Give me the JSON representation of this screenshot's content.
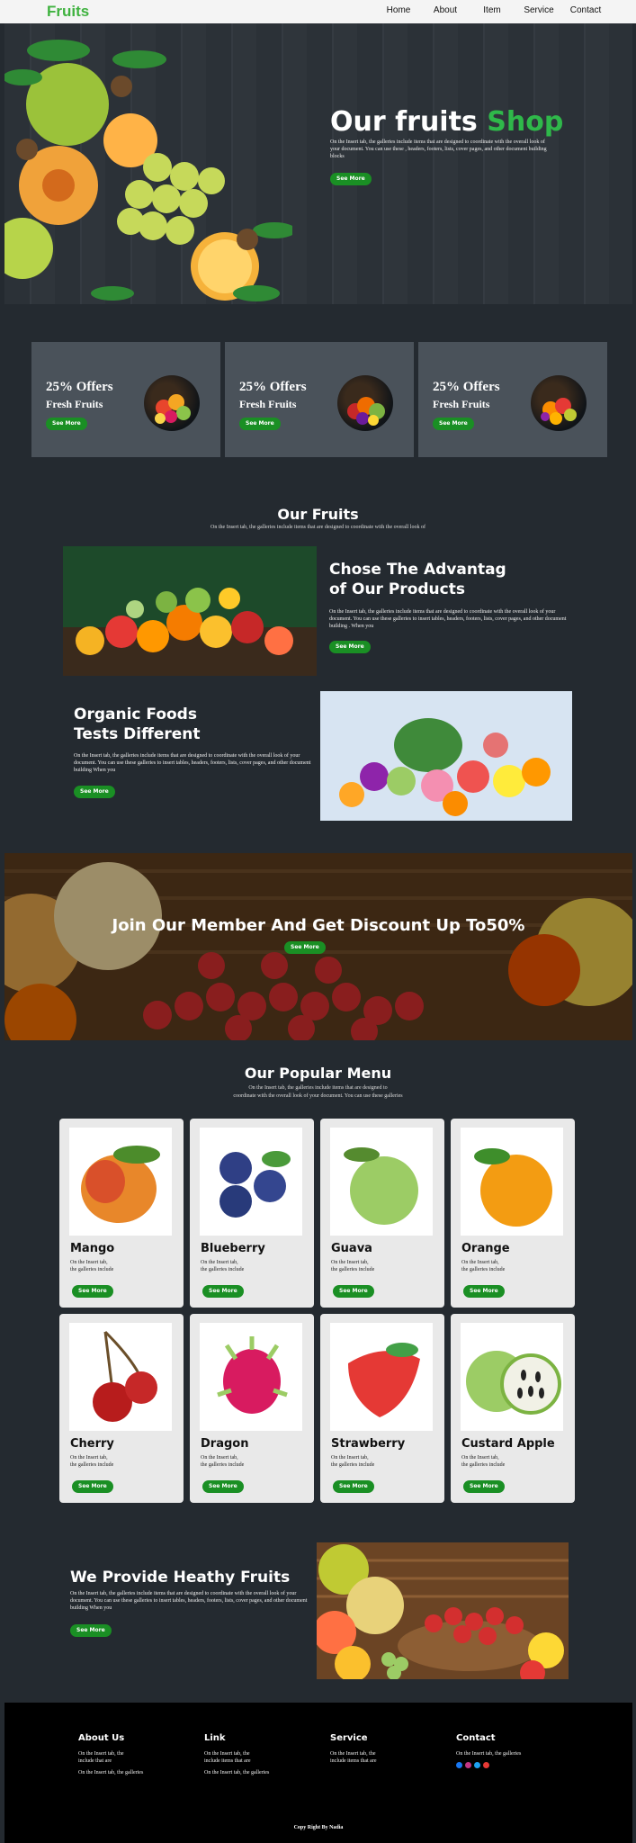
{
  "nav": {
    "logo": "Fruits",
    "links": [
      "Home",
      "About",
      "Item",
      "Service",
      "Contact"
    ]
  },
  "hero": {
    "title_main": "Our fruits",
    "title_accent": "Shop",
    "text": "On the Insert tab, the galleries include items that are designed to coordinate with the overall look of your document. You can use these , headers, footers, lists, cover pages, and other document building blocks",
    "button": "See More"
  },
  "offers": [
    {
      "title": "25% Offers",
      "subtitle": "Fresh Fruits",
      "button": "See More"
    },
    {
      "title": "25% Offers",
      "subtitle": "Fresh Fruits",
      "button": "See More"
    },
    {
      "title": "25% Offers",
      "subtitle": "Fresh Fruits",
      "button": "See More"
    }
  ],
  "our_fruits": {
    "title": "Our Fruits",
    "subtitle": "On the Insert tab, the galleries include items that are designed to coordinate with the overall look of"
  },
  "feature1": {
    "heading_line1": "Chose The Advantag",
    "heading_line2": "of Our Products",
    "text": "On the Insert tab, the galleries include items that are designed to coordinate with the overall look of your document. You can use these galleries to insert tables, headers, footers, lists, cover pages, and other document building . When you",
    "button": "See More"
  },
  "feature2": {
    "heading_line1": "Organic Foods",
    "heading_line2": "Tests Different",
    "text": "On the Insert tab, the galleries include items that are designed to coordinate with the overall look of your document. You can use these galleries to insert tables, headers, footers, lists, cover pages, and other document building When you",
    "button": "See More"
  },
  "banner": {
    "title": "Join Our Member And Get Discount Up To50%",
    "button": "See More"
  },
  "menu": {
    "title": "Our Popular Menu",
    "subtitle_line1": "On the Insert tab, the galleries include items that are designed to",
    "subtitle_line2": "coordinate with the overall look of your document. You can use these galleries",
    "items": [
      {
        "name": "Mango",
        "desc1": "On the Insert tab,",
        "desc2": "the galleries include",
        "button": "See More"
      },
      {
        "name": "Blueberry",
        "desc1": "On the Insert tab,",
        "desc2": "the galleries include",
        "button": "See More"
      },
      {
        "name": "Guava",
        "desc1": "On the Insert tab,",
        "desc2": "the galleries include",
        "button": "See More"
      },
      {
        "name": "Orange",
        "desc1": "On the Insert tab,",
        "desc2": "the galleries include",
        "button": "See More"
      },
      {
        "name": "Cherry",
        "desc1": "On the Insert tab,",
        "desc2": "the galleries include",
        "button": "See More"
      },
      {
        "name": "Dragon",
        "desc1": "On the Insert tab,",
        "desc2": "the galleries include",
        "button": "See More"
      },
      {
        "name": "Strawberry",
        "desc1": "On the Insert tab,",
        "desc2": "the galleries include",
        "button": "See More"
      },
      {
        "name": "Custard Apple",
        "desc1": "On the Insert tab,",
        "desc2": "the galleries include",
        "button": "See More"
      }
    ]
  },
  "provide": {
    "title": "We Provide Heathy Fruits",
    "text": "On the Insert tab, the galleries include items that are designed to coordinate with the overall look of your document. You can use these galleries to insert tables, headers, footers, lists, cover pages, and other document building When you",
    "button": "See More"
  },
  "footer": {
    "about_h": "About Us",
    "about_l1": "On the Insert tab, the",
    "about_l2": "include that are",
    "about_l3": "On the Insert tab, the galleries",
    "link_h": "Link",
    "link_l1": "On the Insert tab, the",
    "link_l2": "include items that are",
    "link_l3": "On the Insert tab, the galleries",
    "service_h": "Service",
    "service_l1": "On the Insert tab, the",
    "service_l2": "include items that are",
    "contact_h": "Contact",
    "contact_l1": "On the Insert tab, the galleries",
    "social_icons": [
      "facebook-icon",
      "instagram-icon",
      "twitter-icon",
      "youtube-icon"
    ],
    "copyright": "Copy Right By Nadia"
  }
}
